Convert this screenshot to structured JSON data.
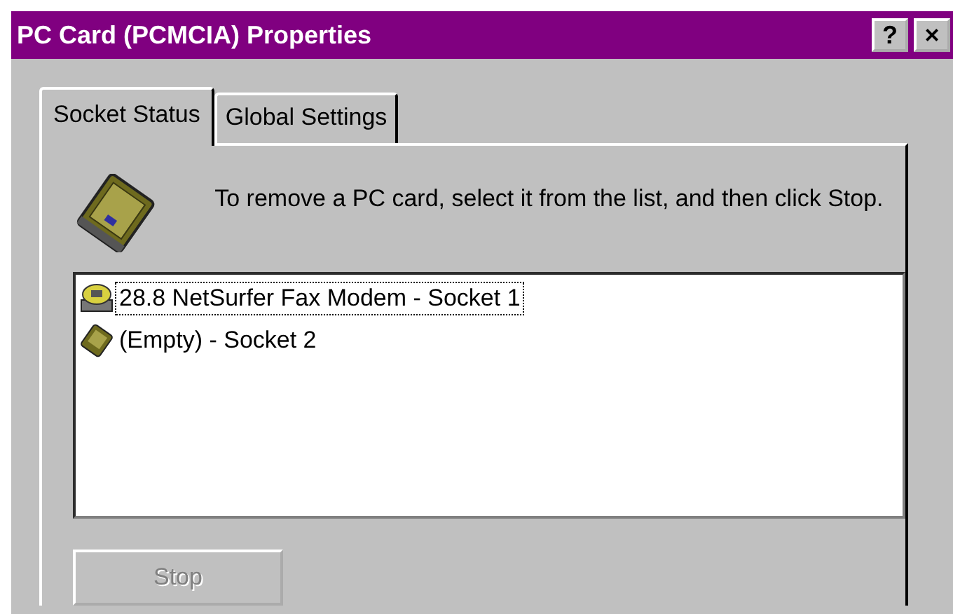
{
  "window": {
    "title": "PC Card (PCMCIA) Properties",
    "help_button": "?",
    "close_button": "×"
  },
  "tabs": [
    {
      "label": "Socket Status",
      "selected": true
    },
    {
      "label": "Global Settings",
      "selected": false
    }
  ],
  "instruction": "To remove a PC card, select it from the list, and then click Stop.",
  "sockets": [
    {
      "kind": "modem",
      "label": "28.8 NetSurfer Fax Modem - Socket 1",
      "selected": true
    },
    {
      "kind": "card",
      "label": "(Empty) - Socket 2",
      "selected": false
    }
  ],
  "stop_button": {
    "label": "Stop",
    "disabled": true
  }
}
